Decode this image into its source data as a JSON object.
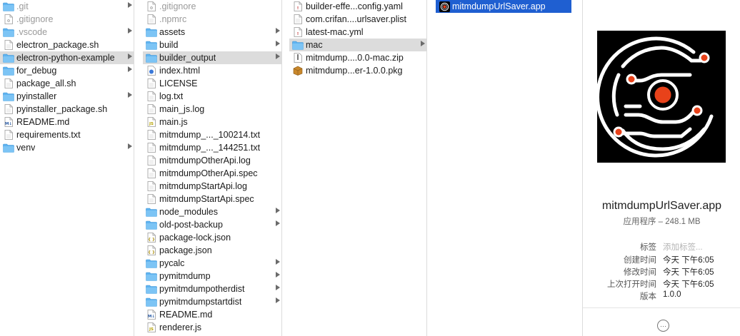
{
  "columns": [
    {
      "items": [
        {
          "label": ".git",
          "icon": "folder-icon",
          "chevron": true,
          "state": "dim"
        },
        {
          "label": ".gitignore",
          "icon": "gear-doc-icon",
          "chevron": false,
          "state": "dim"
        },
        {
          "label": ".vscode",
          "icon": "folder-icon",
          "chevron": true,
          "state": "dim"
        },
        {
          "label": "electron_package.sh",
          "icon": "document-icon",
          "chevron": false,
          "state": ""
        },
        {
          "label": "electron-python-example",
          "icon": "folder-icon",
          "chevron": true,
          "state": "sel"
        },
        {
          "label": "for_debug",
          "icon": "folder-icon",
          "chevron": true,
          "state": ""
        },
        {
          "label": "package_all.sh",
          "icon": "document-icon",
          "chevron": false,
          "state": ""
        },
        {
          "label": "pyinstaller",
          "icon": "folder-icon",
          "chevron": true,
          "state": ""
        },
        {
          "label": "pyinstaller_package.sh",
          "icon": "document-icon",
          "chevron": false,
          "state": ""
        },
        {
          "label": "README.md",
          "icon": "markdown-icon",
          "chevron": false,
          "state": ""
        },
        {
          "label": "requirements.txt",
          "icon": "document-icon",
          "chevron": false,
          "state": ""
        },
        {
          "label": "venv",
          "icon": "folder-icon",
          "chevron": true,
          "state": ""
        }
      ]
    },
    {
      "items": [
        {
          "label": ".gitignore",
          "icon": "gear-doc-icon",
          "chevron": false,
          "state": "dim"
        },
        {
          "label": ".npmrc",
          "icon": "document-icon",
          "chevron": false,
          "state": "dim"
        },
        {
          "label": "assets",
          "icon": "folder-icon",
          "chevron": true,
          "state": ""
        },
        {
          "label": "build",
          "icon": "folder-icon",
          "chevron": true,
          "state": ""
        },
        {
          "label": "builder_output",
          "icon": "folder-icon",
          "chevron": true,
          "state": "sel"
        },
        {
          "label": "index.html",
          "icon": "html-icon",
          "chevron": false,
          "state": ""
        },
        {
          "label": "LICENSE",
          "icon": "document-icon",
          "chevron": false,
          "state": ""
        },
        {
          "label": "log.txt",
          "icon": "document-icon",
          "chevron": false,
          "state": ""
        },
        {
          "label": "main_js.log",
          "icon": "document-icon",
          "chevron": false,
          "state": ""
        },
        {
          "label": "main.js",
          "icon": "js-icon",
          "chevron": false,
          "state": ""
        },
        {
          "label": "mitmdump_..._100214.txt",
          "icon": "document-icon",
          "chevron": false,
          "state": ""
        },
        {
          "label": "mitmdump_..._144251.txt",
          "icon": "document-icon",
          "chevron": false,
          "state": ""
        },
        {
          "label": "mitmdumpOtherApi.log",
          "icon": "document-icon",
          "chevron": false,
          "state": ""
        },
        {
          "label": "mitmdumpOtherApi.spec",
          "icon": "document-icon",
          "chevron": false,
          "state": ""
        },
        {
          "label": "mitmdumpStartApi.log",
          "icon": "document-icon",
          "chevron": false,
          "state": ""
        },
        {
          "label": "mitmdumpStartApi.spec",
          "icon": "document-icon",
          "chevron": false,
          "state": ""
        },
        {
          "label": "node_modules",
          "icon": "folder-icon",
          "chevron": true,
          "state": ""
        },
        {
          "label": "old-post-backup",
          "icon": "folder-icon",
          "chevron": true,
          "state": ""
        },
        {
          "label": "package-lock.json",
          "icon": "json-icon",
          "chevron": false,
          "state": ""
        },
        {
          "label": "package.json",
          "icon": "json-icon",
          "chevron": false,
          "state": ""
        },
        {
          "label": "pycalc",
          "icon": "folder-icon",
          "chevron": true,
          "state": ""
        },
        {
          "label": "pymitmdump",
          "icon": "folder-icon",
          "chevron": true,
          "state": ""
        },
        {
          "label": "pymitmdumpotherdist",
          "icon": "folder-icon",
          "chevron": true,
          "state": ""
        },
        {
          "label": "pymitmdumpstartdist",
          "icon": "folder-icon",
          "chevron": true,
          "state": ""
        },
        {
          "label": "README.md",
          "icon": "markdown-icon",
          "chevron": false,
          "state": ""
        },
        {
          "label": "renderer.js",
          "icon": "js-icon",
          "chevron": false,
          "state": ""
        }
      ]
    },
    {
      "items": [
        {
          "label": "builder-effe...config.yaml",
          "icon": "yaml-icon",
          "chevron": false,
          "state": ""
        },
        {
          "label": "com.crifan....urlsaver.plist",
          "icon": "document-icon",
          "chevron": false,
          "state": ""
        },
        {
          "label": "latest-mac.yml",
          "icon": "yaml-icon",
          "chevron": false,
          "state": ""
        },
        {
          "label": "mac",
          "icon": "folder-icon",
          "chevron": true,
          "state": "sel"
        },
        {
          "label": "mitmdump....0.0-mac.zip",
          "icon": "zip-icon",
          "chevron": false,
          "state": ""
        },
        {
          "label": "mitmdump...er-1.0.0.pkg",
          "icon": "package-icon",
          "chevron": false,
          "state": ""
        }
      ]
    },
    {
      "items": [
        {
          "label": "mitmdumpUrlSaver.app",
          "icon": "app-icon",
          "chevron": false,
          "state": "active"
        }
      ]
    }
  ],
  "preview": {
    "name": "mitmdumpUrlSaver.app",
    "subtitle": "应用程序 – 248.1 MB",
    "tags_label": "标签",
    "tags_placeholder": "添加标签...",
    "created_label": "创建时间",
    "created_value": "今天 下午6:05",
    "modified_label": "修改时间",
    "modified_value": "今天 下午6:05",
    "opened_label": "上次打开时间",
    "opened_value": "今天 下午6:05",
    "version_label": "版本",
    "version_value": "1.0.0",
    "more_label": "···"
  },
  "colors": {
    "selection_active": "#1f5fd1",
    "selection_inactive": "#dcdcdc",
    "folder": "#5fb3f0",
    "logo_bg": "#000000",
    "logo_accent": "#e8421a"
  }
}
